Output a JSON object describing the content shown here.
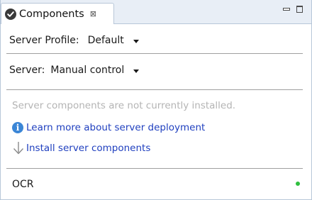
{
  "tab": {
    "title": "Components",
    "close_glyph": "⊠",
    "icon": "check-circle-icon"
  },
  "window_controls": {
    "minimize": "minimize-icon",
    "maximize": "maximize-icon"
  },
  "server_profile": {
    "label": "Server Profile:",
    "value": "Default"
  },
  "server": {
    "label": "Server:",
    "value": "Manual control"
  },
  "components": {
    "status_message": "Server components are not currently installed.",
    "learn_more_link": "Learn more about server deployment",
    "install_link": "Install server components"
  },
  "ocr": {
    "label": "OCR",
    "status_color": "#2fbf3f"
  },
  "colors": {
    "link": "#1f3fbf",
    "muted_text": "#b4b4b4",
    "tabbar_bg": "#e8eef6",
    "info_icon": "#3b86d6"
  }
}
